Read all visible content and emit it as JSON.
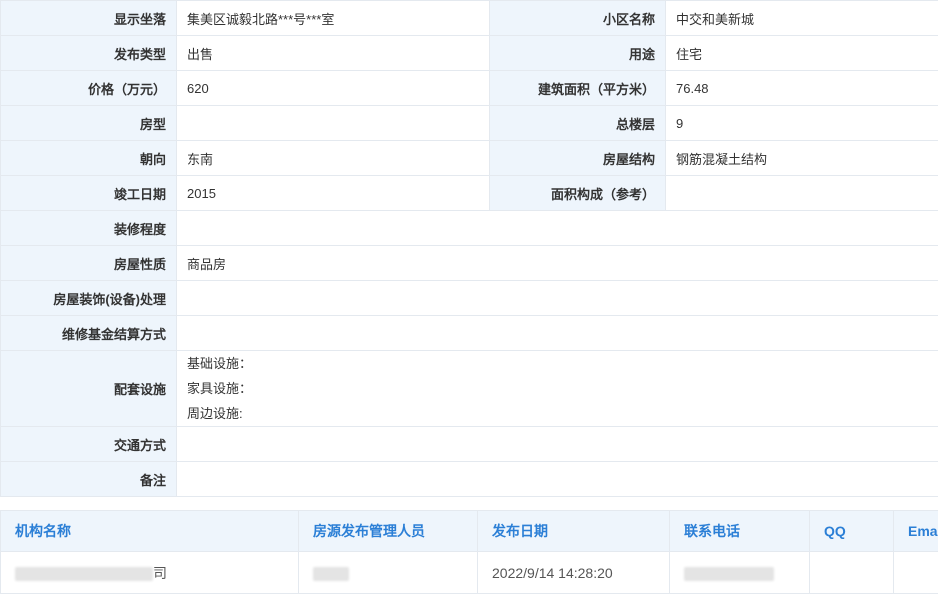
{
  "detail": {
    "rows": [
      {
        "l1": "显示坐落",
        "v1": "集美区诚毅北路***号***室",
        "l2": "小区名称",
        "v2": "中交和美新城"
      },
      {
        "l1": "发布类型",
        "v1": "出售",
        "l2": "用途",
        "v2": "住宅"
      },
      {
        "l1": "价格（万元）",
        "v1": "620",
        "l2": "建筑面积（平方米）",
        "v2": "76.48"
      },
      {
        "l1": "房型",
        "v1": "",
        "l2": "总楼层",
        "v2": "9"
      },
      {
        "l1": "朝向",
        "v1": "东南",
        "l2": "房屋结构",
        "v2": "钢筋混凝土结构"
      },
      {
        "l1": "竣工日期",
        "v1": "2015",
        "l2": "面积构成（参考）",
        "v2": ""
      }
    ],
    "single_rows": [
      {
        "label": "装修程度",
        "value": ""
      },
      {
        "label": "房屋性质",
        "value": "商品房"
      },
      {
        "label": "房屋装饰(设备)处理",
        "value": ""
      },
      {
        "label": "维修基金结算方式",
        "value": ""
      }
    ],
    "facilities": {
      "label": "配套设施",
      "lines": [
        "基础设施：",
        "家具设施：",
        "周边设施:"
      ]
    },
    "trailing_rows": [
      {
        "label": "交通方式",
        "value": ""
      },
      {
        "label": "备注",
        "value": ""
      }
    ]
  },
  "agency": {
    "headers": [
      "机构名称",
      "房源发布管理人员",
      "发布日期",
      "联系电话",
      "QQ",
      "Ema"
    ],
    "row": {
      "name_suffix": "司",
      "date": "2022/9/14 14:28:20"
    }
  },
  "colors": {
    "label_bg": "#eef5fc",
    "header_text": "#2b7fd6",
    "border": "#e4e9ef"
  }
}
